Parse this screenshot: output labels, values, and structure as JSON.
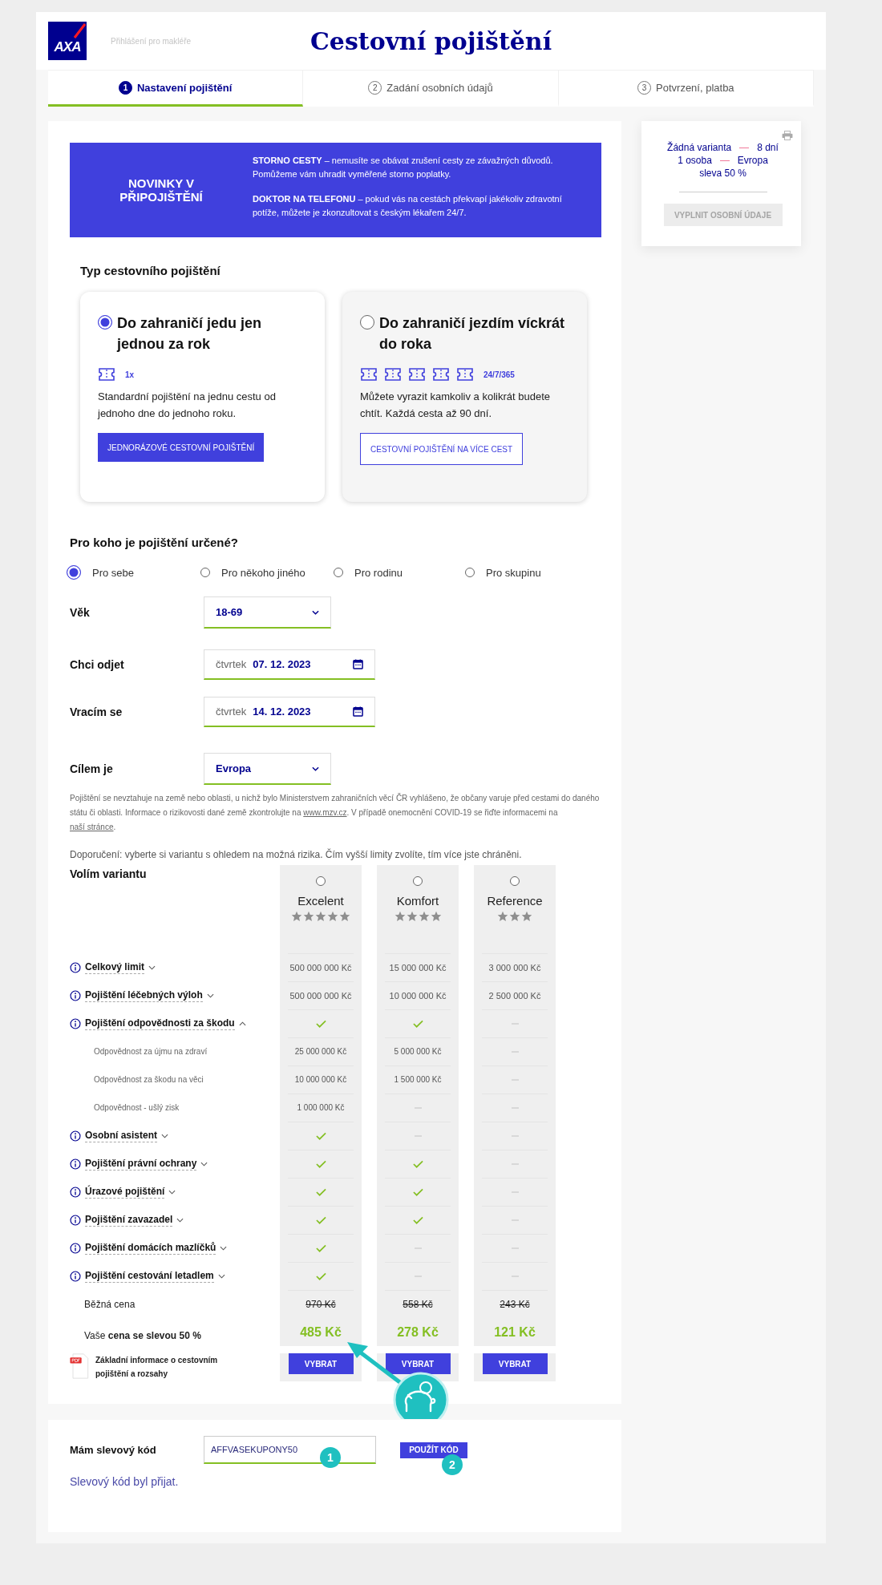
{
  "header": {
    "logo": "AXA",
    "broker_link": "Přihlášení pro makléře",
    "title": "Cestovní pojištění"
  },
  "steps": [
    {
      "number": "1",
      "label": "Nastavení pojištění",
      "selected": true
    },
    {
      "number": "2",
      "label": "Zadání osobních údajů",
      "selected": false
    },
    {
      "number": "3",
      "label": "Potvrzení, platba",
      "selected": false
    }
  ],
  "banner": {
    "heading": "NOVINKY V PŘIPOJIŠTĚNÍ",
    "items": [
      {
        "title": "STORNO CESTY",
        "text": "– nemusíte se obávat zrušení cesty ze závažných důvodů. Pomůžeme vám uhradit vyměřené storno poplatky."
      },
      {
        "title": "DOKTOR NA TELEFONU",
        "text": "– pokud vás na cestách překvapí jakékoliv zdravotní potíže, můžete je zkonzultovat s českým lékařem 24/7."
      }
    ]
  },
  "insurance_type": {
    "heading": "Typ cestovního pojištění",
    "options": [
      {
        "kind": "single",
        "selected": true,
        "title": "Do zahraničí jedu jen jednou za rok",
        "frequency": "1x",
        "description": "Standardní pojištění na jednu cestu od jednoho dne do jednoho roku.",
        "button": "JEDNORÁZOVÉ CESTOVNÍ POJIŠTĚNÍ"
      },
      {
        "kind": "multi",
        "selected": false,
        "title": "Do zahraničí jezdím víckrát do roka",
        "frequency": "24/7/365",
        "description": "Můžete vyrazit kamkoliv a kolikrát budete chtít. Každá cesta až 90 dní.",
        "button": "CESTOVNÍ POJIŠTĚNÍ NA VÍCE CEST"
      }
    ]
  },
  "recipient": {
    "heading": "Pro koho je pojištění určené?",
    "options": [
      {
        "label": "Pro sebe",
        "selected": true
      },
      {
        "label": "Pro někoho jiného",
        "selected": false
      },
      {
        "label": "Pro rodinu",
        "selected": false
      },
      {
        "label": "Pro skupinu",
        "selected": false
      }
    ]
  },
  "fields": [
    {
      "label": "Věk",
      "kind": "select",
      "value": "18-69"
    },
    {
      "label": "Chci odjet",
      "kind": "date",
      "weekday": "čtvrtek",
      "value": "07. 12. 2023"
    },
    {
      "label": "Vracím se",
      "kind": "date",
      "weekday": "čtvrtek",
      "value": "14. 12. 2023"
    },
    {
      "label": "Cílem je",
      "kind": "select",
      "value": "Evropa"
    }
  ],
  "disclaimer": [
    {
      "kind": "text",
      "text": "Pojištění se nevztahuje na země nebo oblasti, u nichž bylo Ministerstvem zahraničních věcí ČR vyhlášeno, že občany varuje před cestami do daného státu či oblasti. Informace o rizikovosti dané země zkontrolujte na "
    },
    {
      "kind": "link",
      "text": "www.mzv.cz"
    },
    {
      "kind": "text",
      "text": ". V případě onemocnění COVID-19 se řiďte informacemi na "
    },
    {
      "kind": "link",
      "text": "naší stránce"
    },
    {
      "kind": "text",
      "text": "."
    }
  ],
  "recommendation": "Doporučení: vyberte si variantu s ohledem na možná rizika. Čím vyšší limity zvolíte, tím více jste chráněni.",
  "variants": {
    "heading": "Volím variantu",
    "columns": [
      {
        "name": "Excelent",
        "selected": false,
        "stars": 5,
        "regular_price": "970 Kč",
        "price": "485 Kč",
        "button": "VYBRAT"
      },
      {
        "name": "Komfort",
        "selected": false,
        "stars": 4,
        "regular_price": "558 Kč",
        "price": "278 Kč",
        "button": "VYBRAT"
      },
      {
        "name": "Reference",
        "selected": false,
        "stars": 3,
        "regular_price": "243 Kč",
        "price": "121 Kč",
        "button": "VYBRAT"
      }
    ],
    "rows": [
      {
        "kind": "main",
        "label": "Celkový limit",
        "expanded": false,
        "values": [
          {
            "kind": "amount",
            "text": "500 000 000 Kč"
          },
          {
            "kind": "amount",
            "text": "15 000 000 Kč"
          },
          {
            "kind": "amount",
            "text": "3 000 000 Kč"
          }
        ]
      },
      {
        "kind": "main",
        "label": "Pojištění léčebných výloh",
        "expanded": false,
        "values": [
          {
            "kind": "amount",
            "text": "500 000 000 Kč"
          },
          {
            "kind": "amount",
            "text": "10 000 000 Kč"
          },
          {
            "kind": "amount",
            "text": "2 500 000 Kč"
          }
        ]
      },
      {
        "kind": "main",
        "label": "Pojištění odpovědnosti za škodu",
        "expanded": true,
        "values": [
          {
            "kind": "check"
          },
          {
            "kind": "check"
          },
          {
            "kind": "dash"
          }
        ]
      },
      {
        "kind": "sub",
        "label": "Odpovědnost za újmu na zdraví",
        "values": [
          {
            "kind": "amount",
            "text": "25 000 000 Kč"
          },
          {
            "kind": "amount",
            "text": "5 000 000 Kč"
          },
          {
            "kind": "dash"
          }
        ]
      },
      {
        "kind": "sub",
        "label": "Odpovědnost za škodu na věci",
        "values": [
          {
            "kind": "amount",
            "text": "10 000 000 Kč"
          },
          {
            "kind": "amount",
            "text": "1 500 000 Kč"
          },
          {
            "kind": "dash"
          }
        ]
      },
      {
        "kind": "sub",
        "label": "Odpovědnost - ušlý zisk",
        "values": [
          {
            "kind": "amount",
            "text": "1 000 000 Kč"
          },
          {
            "kind": "dash"
          },
          {
            "kind": "dash"
          }
        ]
      },
      {
        "kind": "main",
        "label": "Osobní asistent",
        "expanded": false,
        "values": [
          {
            "kind": "check"
          },
          {
            "kind": "dash"
          },
          {
            "kind": "dash"
          }
        ]
      },
      {
        "kind": "main",
        "label": "Pojištění právní ochrany",
        "expanded": false,
        "values": [
          {
            "kind": "check"
          },
          {
            "kind": "check"
          },
          {
            "kind": "dash"
          }
        ]
      },
      {
        "kind": "main",
        "label": "Úrazové pojištění",
        "expanded": false,
        "values": [
          {
            "kind": "check"
          },
          {
            "kind": "check"
          },
          {
            "kind": "dash"
          }
        ]
      },
      {
        "kind": "main",
        "label": "Pojištění zavazadel",
        "expanded": false,
        "values": [
          {
            "kind": "check"
          },
          {
            "kind": "check"
          },
          {
            "kind": "dash"
          }
        ]
      },
      {
        "kind": "main",
        "label": "Pojištění domácích mazlíčků",
        "expanded": false,
        "values": [
          {
            "kind": "check"
          },
          {
            "kind": "dash"
          },
          {
            "kind": "dash"
          }
        ]
      },
      {
        "kind": "main",
        "label": "Pojištění cestování letadlem",
        "expanded": false,
        "values": [
          {
            "kind": "check"
          },
          {
            "kind": "dash"
          },
          {
            "kind": "dash"
          }
        ]
      }
    ],
    "regular_price_label": "Běžná cena",
    "discount_price_label": "Vaše **cena se slevou 50 %**",
    "pdf_link": "Základní informace o cestovním pojištění a rozsahy"
  },
  "sidebar": {
    "summary": [
      {
        "items": [
          "Žádná varianta",
          "8 dní"
        ]
      },
      {
        "items": [
          "1 osoba",
          "Evropa"
        ]
      },
      {
        "items": [
          "sleva 50 %"
        ]
      }
    ],
    "button": {
      "label": "VYPLNIT OSOBNÍ ÚDAJE",
      "disabled": true
    }
  },
  "discount": {
    "label": "Mám slevový kód",
    "value": "AFFVASEKUPONY50",
    "field_badge": "1",
    "button": "POUŽÍT KÓD",
    "button_badge": "2",
    "message": "Slevový kód byl přijat."
  }
}
